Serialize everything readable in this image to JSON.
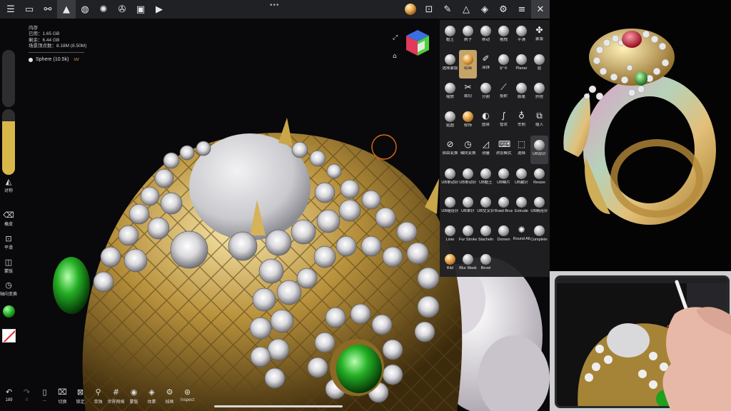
{
  "topbar": {
    "left_icons": [
      "folder-icon",
      "share-nodes-icon",
      "mountain-scene-icon",
      "sphere-grid-icon",
      "sun-icon",
      "film-reel-icon",
      "image-icon",
      "video-icon"
    ],
    "more_dots": "•••",
    "right_icons": [
      "material-ball-icon",
      "frame-icon",
      "brush-icon",
      "wand-icon",
      "layers-icon",
      "settings-icon",
      "sliders-icon",
      "tools-close-icon"
    ]
  },
  "stats": {
    "title": "内存",
    "used": "已用：1.65 GB",
    "free": "剩余：6.44 GB",
    "vertex": "场景顶点数：8.18M (8.50M)"
  },
  "mesh": {
    "name": "Sphere (10.5k)",
    "uv": "uv"
  },
  "left_toolbar": {
    "symmetry": "对称",
    "erase": "橡皮",
    "smooth": "平滑",
    "mask": "蒙版",
    "axis_transform": "轴向变换"
  },
  "bottom_toolbar": [
    {
      "icon": "undo-icon",
      "label": "189"
    },
    {
      "icon": "redo-icon",
      "label": "0"
    },
    {
      "icon": "tablet-icon",
      "label": "..."
    },
    {
      "icon": "camera-switch-icon",
      "label": "切换"
    },
    {
      "icon": "lock-icon",
      "label": "锁定"
    },
    {
      "icon": "isolate-icon",
      "label": "单独"
    },
    {
      "icon": "world-grid-icon",
      "label": "世界网格"
    },
    {
      "icon": "eye-icon",
      "label": "蒙版"
    },
    {
      "icon": "voxel-icon",
      "label": "体素"
    },
    {
      "icon": "wireframe-icon",
      "label": "线框"
    },
    {
      "icon": "inspect-icon",
      "label": "Inspect"
    }
  ],
  "brushes": [
    {
      "label": "黏土",
      "kind": "ball"
    },
    {
      "label": "刷子",
      "kind": "ball"
    },
    {
      "label": "移动",
      "kind": "ball"
    },
    {
      "label": "拖拽",
      "kind": "ball"
    },
    {
      "label": "平滑",
      "kind": "ball"
    },
    {
      "label": "蒙版",
      "kind": "glyph",
      "glyph": "✤"
    },
    {
      "label": "选择蒙版",
      "kind": "ball"
    },
    {
      "label": "绘画",
      "kind": "gold",
      "selected": true
    },
    {
      "label": "涂抹",
      "kind": "glyph",
      "glyph": "✐"
    },
    {
      "label": "铲平",
      "kind": "ball"
    },
    {
      "label": "Planar",
      "kind": "ball"
    },
    {
      "label": "层",
      "kind": "ball"
    },
    {
      "label": "缩放",
      "kind": "ball"
    },
    {
      "label": "裁切",
      "kind": "glyph",
      "glyph": "✂"
    },
    {
      "label": "分割",
      "kind": "ball"
    },
    {
      "label": "投射",
      "kind": "glyph",
      "glyph": "⟋"
    },
    {
      "label": "膨胀",
      "kind": "ball"
    },
    {
      "label": "挤捏",
      "kind": "ball"
    },
    {
      "label": "贴图",
      "kind": "ball"
    },
    {
      "label": "修饰",
      "kind": "gold"
    },
    {
      "label": "图章",
      "kind": "glyph",
      "glyph": "◐"
    },
    {
      "label": "管状",
      "kind": "glyph",
      "glyph": "∫"
    },
    {
      "label": "车削",
      "kind": "glyph",
      "glyph": "♁"
    },
    {
      "label": "插入",
      "kind": "glyph",
      "glyph": "⧉"
    },
    {
      "label": "自由变换",
      "kind": "glyph",
      "glyph": "⊘"
    },
    {
      "label": "轴向变换",
      "kind": "glyph",
      "glyph": "◷"
    },
    {
      "label": "测量",
      "kind": "glyph",
      "glyph": "◿"
    },
    {
      "label": "浏览模式",
      "kind": "glyph",
      "glyph": "⌨"
    },
    {
      "label": "选择",
      "kind": "glyph",
      "glyph": "⬚"
    },
    {
      "label": "UB双针",
      "kind": "ball",
      "alt": true
    },
    {
      "label": "UB单动针",
      "kind": "ball"
    },
    {
      "label": "UB单动针",
      "kind": "ball"
    },
    {
      "label": "UB黏土",
      "kind": "ball"
    },
    {
      "label": "UB鳞片",
      "kind": "ball"
    },
    {
      "label": "UB藏针",
      "kind": "ball"
    },
    {
      "label": "Resize",
      "kind": "ball"
    },
    {
      "label": "UB缩连针",
      "kind": "ball"
    },
    {
      "label": "UB单针",
      "kind": "ball"
    },
    {
      "label": "UB交叉针",
      "kind": "ball"
    },
    {
      "label": "Braid Brush",
      "kind": "ball"
    },
    {
      "label": "Extrude",
      "kind": "ball"
    },
    {
      "label": "UB精连针",
      "kind": "ball"
    },
    {
      "label": "Linie",
      "kind": "ball"
    },
    {
      "label": "Fur Stroke",
      "kind": "ball"
    },
    {
      "label": "Stacheln",
      "kind": "ball"
    },
    {
      "label": "Dornen",
      "kind": "ball"
    },
    {
      "label": "Round All",
      "kind": "glyph",
      "glyph": "✺"
    },
    {
      "label": "Complete Alpha",
      "kind": "ball"
    },
    {
      "label": "Bild",
      "kind": "gold"
    },
    {
      "label": "Blur Mask",
      "kind": "ball"
    },
    {
      "label": "Bevel",
      "kind": "ball"
    }
  ]
}
